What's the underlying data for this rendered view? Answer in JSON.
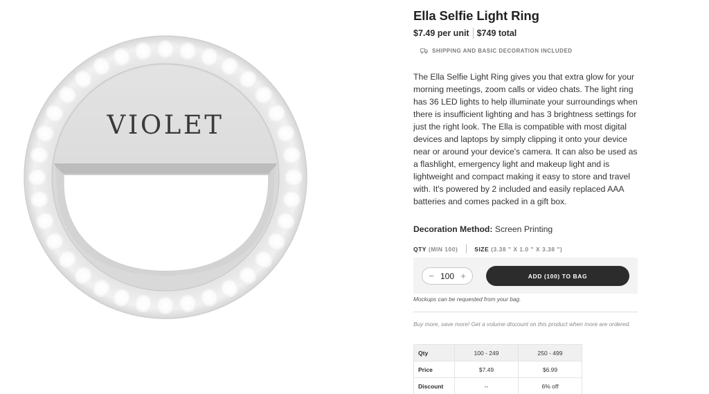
{
  "product": {
    "brand_text": "VIOLET",
    "title": "Ella Selfie Light Ring",
    "price_per_unit": "$7.49 per unit",
    "price_total": "$749 total",
    "shipping_note": "SHIPPING AND BASIC DECORATION INCLUDED",
    "description": "The Ella Selfie Light Ring gives you that extra glow for your morning meetings, zoom calls or video chats. The light ring has 36 LED lights to help illuminate your surroundings when there is insufficient lighting and has 3 brightness settings for just the right look. The Ella is compatible with most digital devices and laptops by simply clipping it onto your device near or around your device's camera. It can also be used as a flashlight, emergency light and makeup light and is lightweight and compact making it easy to store and travel with. It's powered by 2 included and easily replaced AAA batteries and comes packed in a gift box.",
    "decoration_label": "Decoration Method:",
    "decoration_value": "Screen Printing"
  },
  "options": {
    "qty_label": "QTY",
    "qty_hint": "(MIN 100)",
    "size_label": "SIZE",
    "size_value": "(3.38 \" X 1.0 \" X 3.38 \")"
  },
  "cart": {
    "minus_symbol": "−",
    "quantity": "100",
    "plus_symbol": "+",
    "add_button_label": "ADD (100) TO BAG",
    "mockup_note": "Mockups can be requested from your bag.",
    "volume_promo": "Buy more, save more! Get a volume discount on this product when more are ordered."
  },
  "pricing_table": {
    "rows": [
      {
        "label": "Qty",
        "tier1": "100 - 249",
        "tier2": "250 - 499"
      },
      {
        "label": "Price",
        "tier1": "$7.49",
        "tier2": "$6.99"
      },
      {
        "label": "Discount",
        "tier1": "--",
        "tier2": "6% off"
      }
    ]
  },
  "icons": {
    "shipping": "truck-icon",
    "minus": "minus-icon",
    "plus": "plus-icon"
  },
  "colors": {
    "button_bg": "#2c2c2c",
    "cart_panel_bg": "#f3f3f3",
    "table_header_bg": "#f0f0f0"
  }
}
